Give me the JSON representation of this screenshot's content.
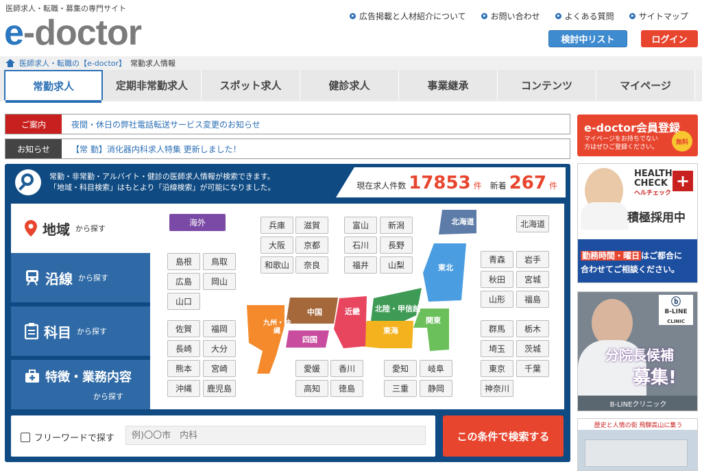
{
  "header": {
    "tagline": "医師求人・転職・募集の専門サイト",
    "logo_e": "e",
    "logo_rest": "-doctor",
    "links": [
      "広告掲載と人材紹介について",
      "お問い合わせ",
      "よくある質問",
      "サイトマップ"
    ],
    "list_button": "検討中リスト",
    "login_button": "ログイン"
  },
  "breadcrumb": {
    "link": "医師求人・転職の【e-doctor】",
    "current": "常勤求人情報"
  },
  "nav": {
    "tabs": [
      "常勤求人",
      "定期非常勤求人",
      "スポット求人",
      "健診求人",
      "事業継承",
      "コンテンツ",
      "マイページ"
    ]
  },
  "notices": [
    {
      "label": "ご案内",
      "text": "夜間・休日の弊社電話転送サービス変更のお知らせ",
      "color": "#c8201e"
    },
    {
      "label": "お知らせ",
      "text": "【常 勤】消化器内科求人特集 更新しました！",
      "color": "#444444"
    }
  ],
  "search": {
    "intro_line1": "常勤・非常勤・アルバイト・健診の医師求人情報が検索できます。",
    "intro_line2": "「地域・科目検索」はもとより「沿線検索」が可能になりました。",
    "count_label": "現在求人件数",
    "count_value": "17853",
    "count_unit": "件",
    "new_label": "新着",
    "new_value": "267",
    "new_unit": "件",
    "side_tabs": [
      {
        "big": "地域",
        "small": "から探す"
      },
      {
        "big": "沿線",
        "small": "から探す"
      },
      {
        "big": "科目",
        "small": "から探す"
      },
      {
        "big": "特徴・業務内容",
        "small": "から探す"
      }
    ],
    "overseas": "海外",
    "regions": {
      "hokkaido": "北海道",
      "tohoku": "東北",
      "kanto": "関東",
      "hokuriku": "北陸・甲信越",
      "tokai": "東海",
      "kinki": "近畿",
      "chugoku": "中国",
      "shikoku": "四国",
      "kyushu": "九州・沖縄"
    },
    "prefs": {
      "chugoku": [
        "島根",
        "鳥取",
        "広島",
        "岡山",
        "山口"
      ],
      "kyushu": [
        "佐賀",
        "福岡",
        "長崎",
        "大分",
        "熊本",
        "宮崎",
        "沖縄",
        "鹿児島"
      ],
      "kinki1": [
        "兵庫",
        "滋賀",
        "大阪",
        "京都",
        "和歌山",
        "奈良"
      ],
      "hokuriku": [
        "富山",
        "新潟",
        "石川",
        "長野",
        "福井",
        "山梨"
      ],
      "hokkaido": [
        "北海道"
      ],
      "tohoku": [
        "青森",
        "岩手",
        "秋田",
        "宮城",
        "山形",
        "福島"
      ],
      "kanto": [
        "群馬",
        "栃木",
        "埼玉",
        "茨城",
        "東京",
        "千葉",
        "神奈川"
      ],
      "shikoku": [
        "愛媛",
        "香川",
        "高知",
        "徳島"
      ],
      "tokai": [
        "愛知",
        "岐阜",
        "三重",
        "静岡"
      ]
    },
    "freeword_label": "フリーワードで探す",
    "freeword_placeholder": "例)〇〇市　内科",
    "submit": "この条件で検索する"
  },
  "sidebar": {
    "register_title": "e-doctor会員登録",
    "register_sub1": "マイページをお持ちでない",
    "register_sub2": "方はぜひご登録ください。",
    "register_badge": "無料",
    "banner1_brand1": "HEALTH",
    "banner1_brand2": "CHECK",
    "banner1_sub": "ヘルチェック",
    "banner1_title": "積極採用中",
    "banner1_hl": "勤務時間・曜日",
    "banner1_text1": "はご都合に",
    "banner1_text2": "合わせてご相談ください。",
    "banner2_logo": "B-LINE",
    "banner2_logo_sub": "CLINIC",
    "banner2_title1": "分院長候補",
    "banner2_title2": "募集!",
    "banner2_footer": "B-LINEクリニック",
    "banner3_text": "歴史と人情の街 飛騨高山に集う"
  }
}
